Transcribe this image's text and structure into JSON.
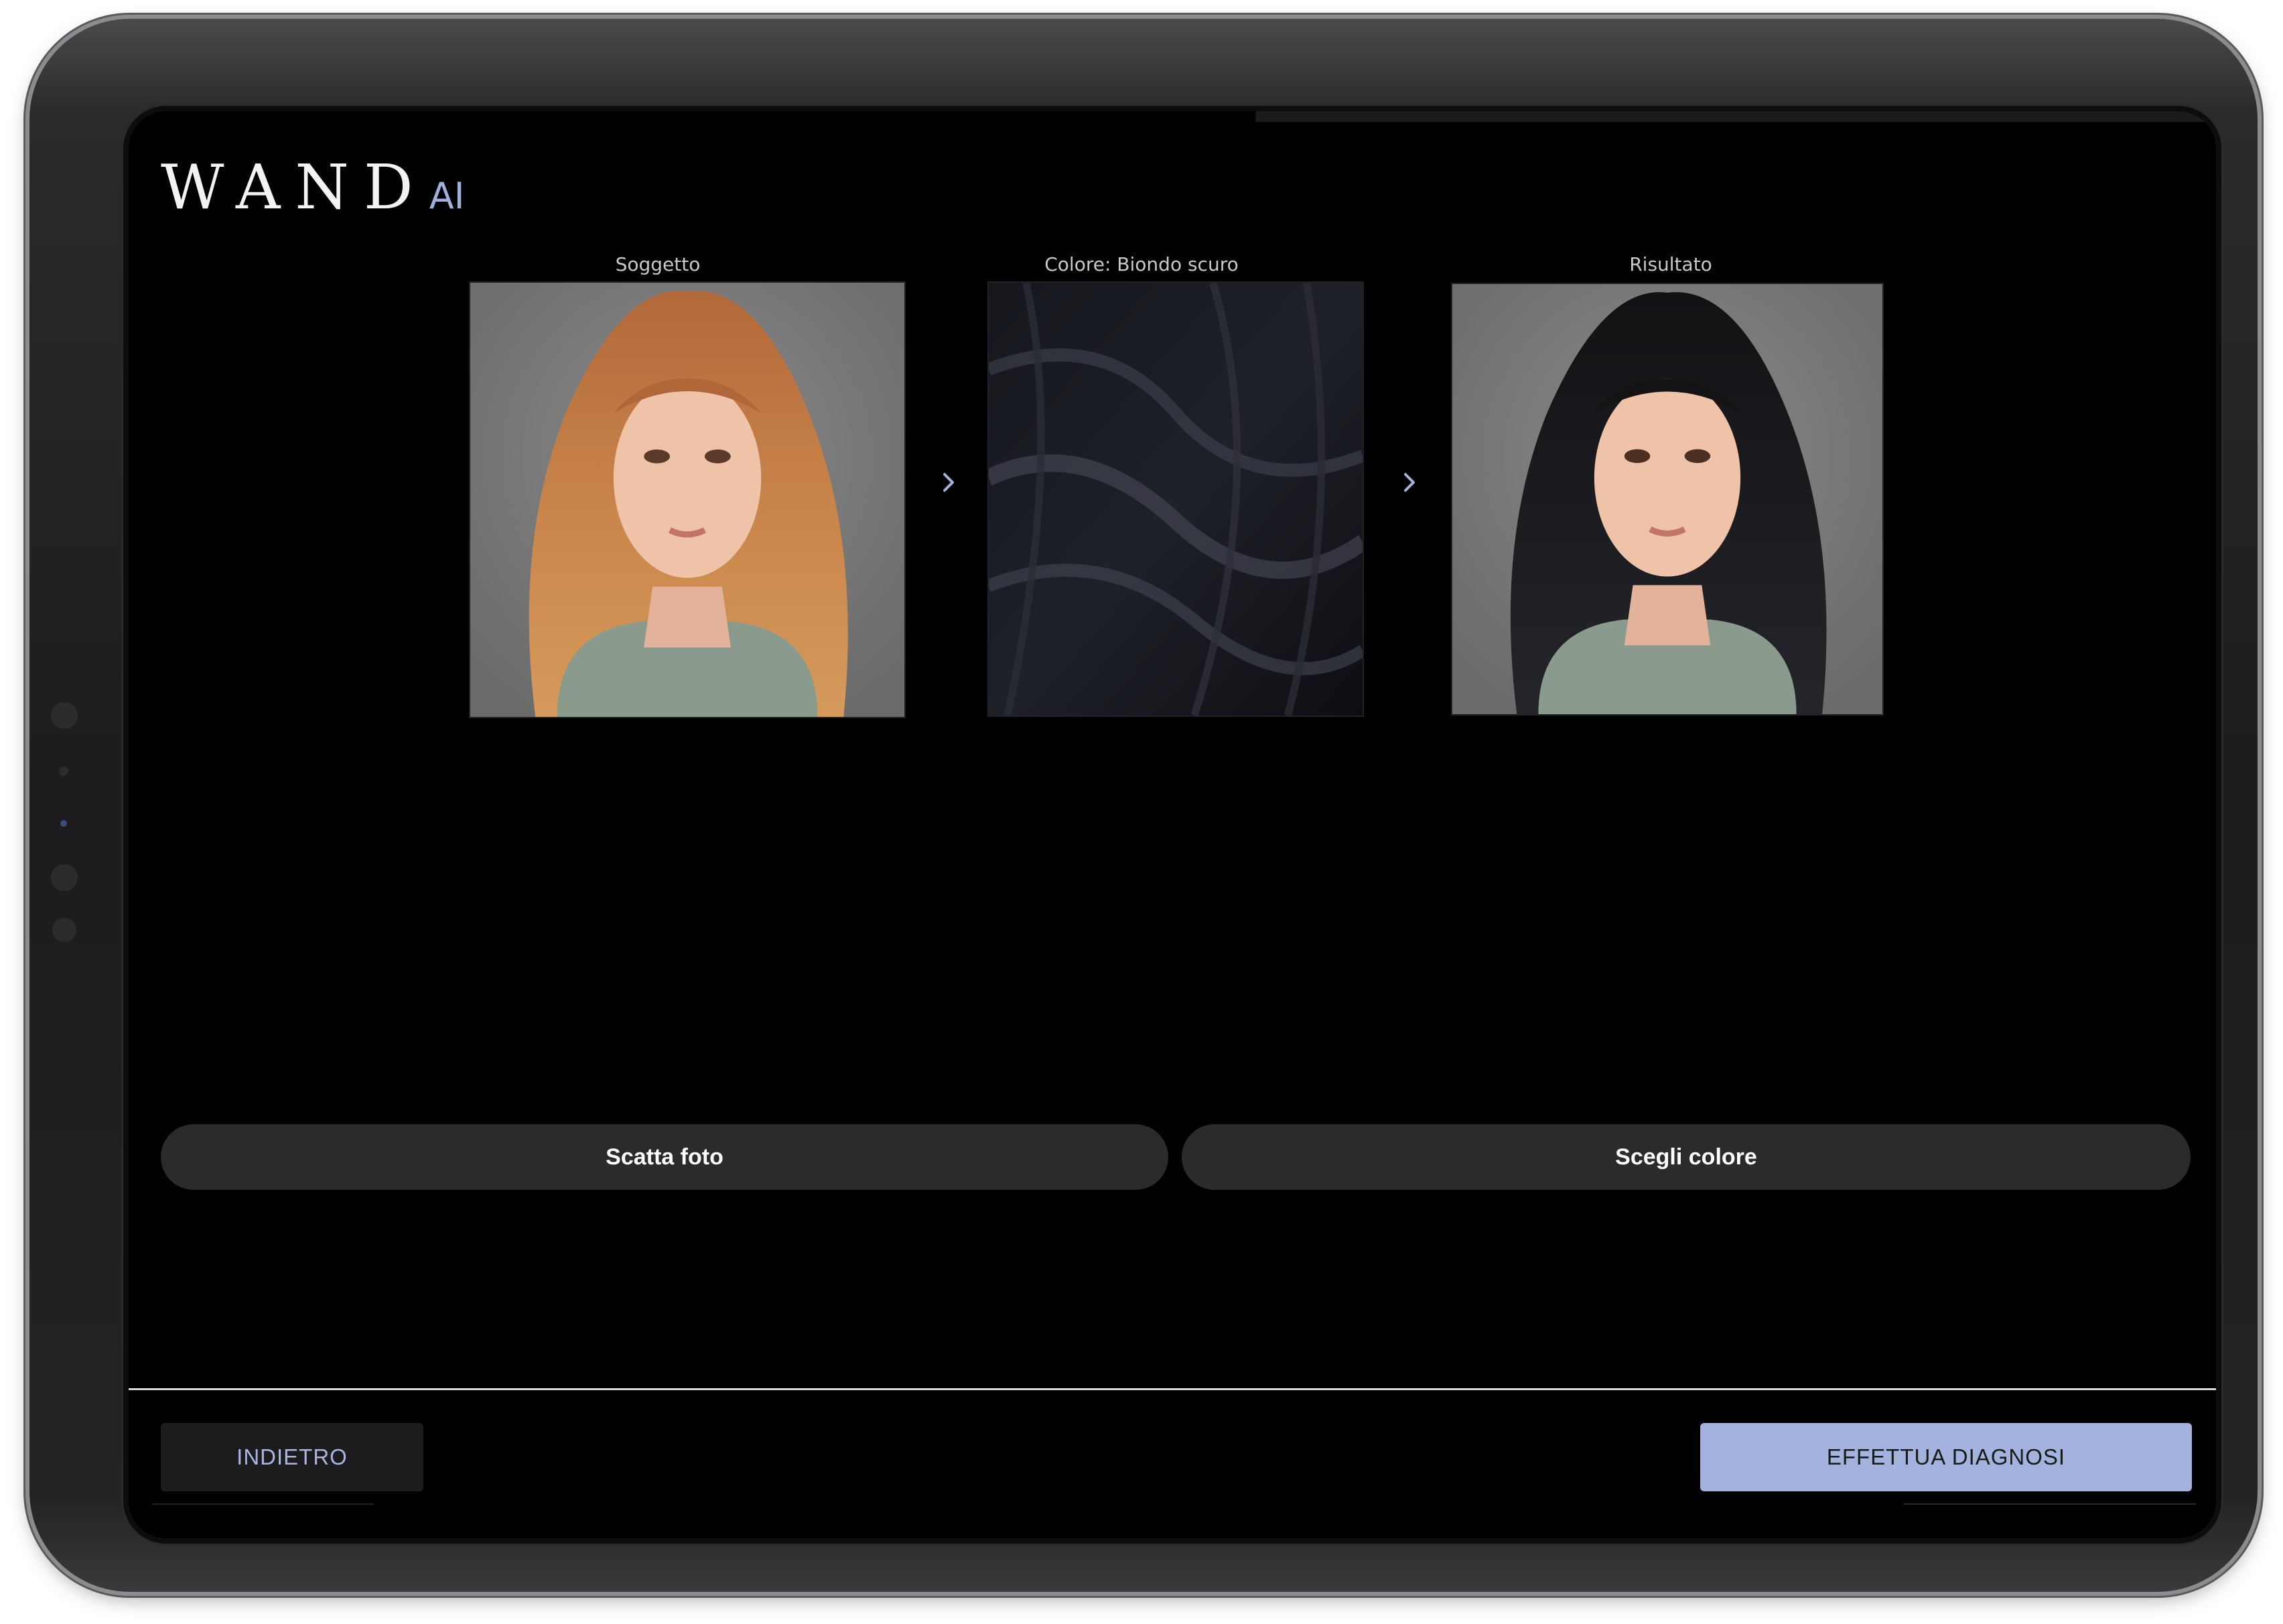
{
  "brand": {
    "name": "WAND",
    "suffix": "AI"
  },
  "panels": [
    {
      "label": "Soggetto",
      "image": "woman-auburn-wavy-hair-portrait"
    },
    {
      "label": "Colore: Biondo scuro",
      "image": "dark-hair-swatch"
    },
    {
      "label": "Risultato",
      "image": "woman-black-wavy-hair-portrait"
    }
  ],
  "actions": {
    "take_photo": "Scatta foto",
    "choose_color": "Scegli colore"
  },
  "footer": {
    "back": "INDIETRO",
    "diagnose": "EFFETTUA DIAGNOSI"
  },
  "colors": {
    "accent": "#a3b3dd",
    "background": "#000000",
    "pill": "#2b2b2d"
  },
  "icons": {
    "arrow": "chevron-right-icon"
  }
}
